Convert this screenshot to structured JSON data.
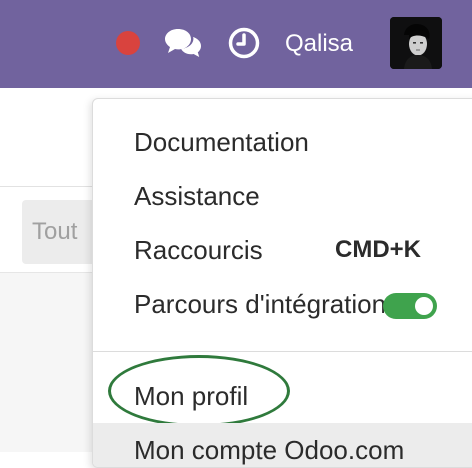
{
  "topbar": {
    "background": "#71639e",
    "status_color": "#d9433e",
    "icons": [
      "status-dot",
      "chat-icon",
      "clock-icon"
    ],
    "username": "Qalisa"
  },
  "background_page": {
    "search_placeholder": "Tout"
  },
  "user_menu": {
    "items": [
      {
        "label": "Documentation"
      },
      {
        "label": "Assistance"
      },
      {
        "label": "Raccourcis",
        "shortcut": "CMD+K"
      },
      {
        "label": "Parcours d'intégration",
        "toggle_on": true,
        "toggle_color": "#3fa34d"
      },
      {
        "label": "Mon profil",
        "highlighted_by_annotation": true
      },
      {
        "label": "Mon compte Odoo.com",
        "hovered": true
      }
    ]
  },
  "annotation": {
    "color": "#2f7a3c",
    "shape": "ellipse"
  }
}
